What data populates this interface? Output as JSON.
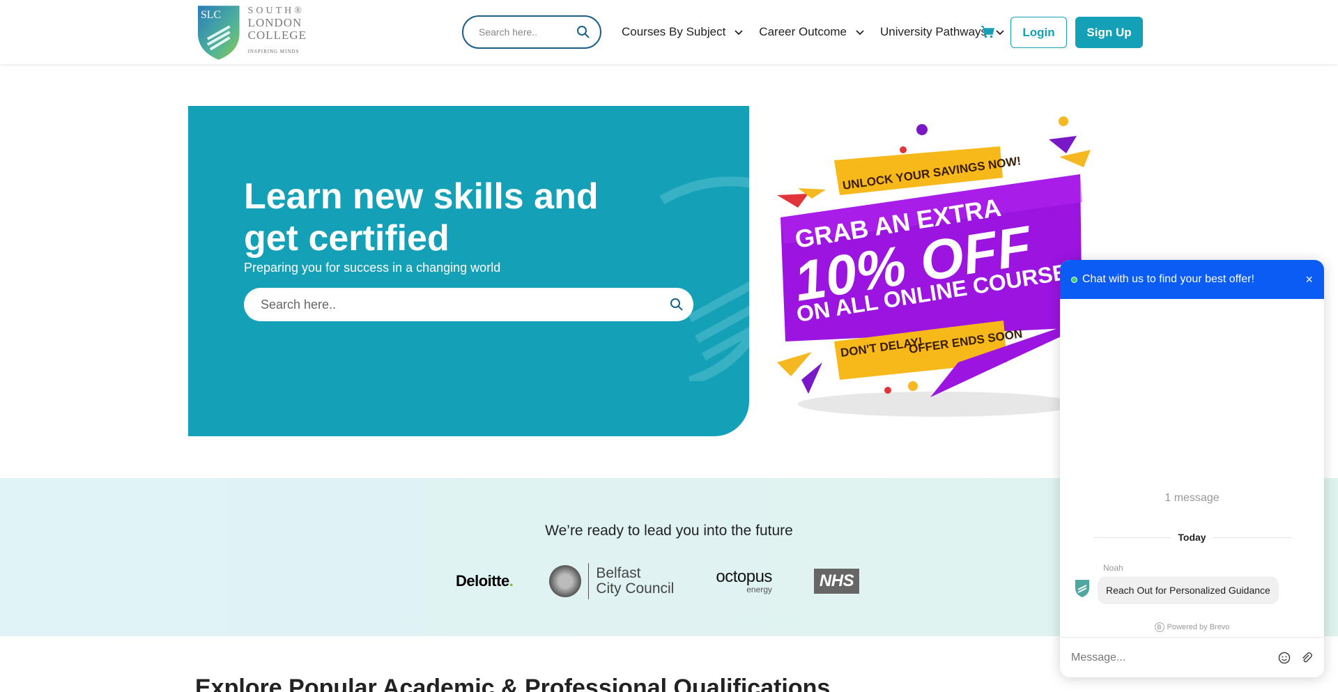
{
  "header": {
    "logo": {
      "line1": "SOUTH®",
      "line2": "LONDON",
      "line3": "COLLEGE",
      "tagline": "INSPIRING MINDS",
      "monogram": "SLC"
    },
    "search_placeholder": "Search here..",
    "nav": [
      {
        "label": "Courses By Subject"
      },
      {
        "label": "Career Outcome"
      },
      {
        "label": "University Pathways"
      }
    ],
    "login_label": "Login",
    "signup_label": "Sign Up",
    "accent_color": "#14a0b6"
  },
  "hero": {
    "title": "Learn new skills and get certified",
    "subtitle": "Preparing you for success in a changing world",
    "search_placeholder": "Search here..",
    "bg_color": "#14a0b6"
  },
  "promo": {
    "line1": "UNLOCK YOUR SAVINGS NOW!",
    "line2": "GRAB AN EXTRA",
    "line3": "10% OFF",
    "line4": "ON ALL ONLINE COURSES",
    "line5": "DON'T DELAY!",
    "line6": "OFFER ENDS SOON"
  },
  "partners": {
    "tagline": "We’re ready to lead you into the future",
    "logos": {
      "deloitte": "Deloitte",
      "belfast_l1": "Belfast",
      "belfast_l2": "City Council",
      "octopus": "octopus",
      "octopus_sub": "energy",
      "nhs": "NHS"
    }
  },
  "explore_heading": "Explore Popular Academic & Professional Qualifications",
  "chat": {
    "header": "Chat with us to find your best offer!",
    "close_icon": "×",
    "message_count": "1 message",
    "day_label": "Today",
    "sender": "Noah",
    "message": "Reach Out for Personalized Guidance",
    "powered_by": "Powered by Brevo",
    "input_placeholder": "Message...",
    "header_color": "#0a5cf5"
  }
}
